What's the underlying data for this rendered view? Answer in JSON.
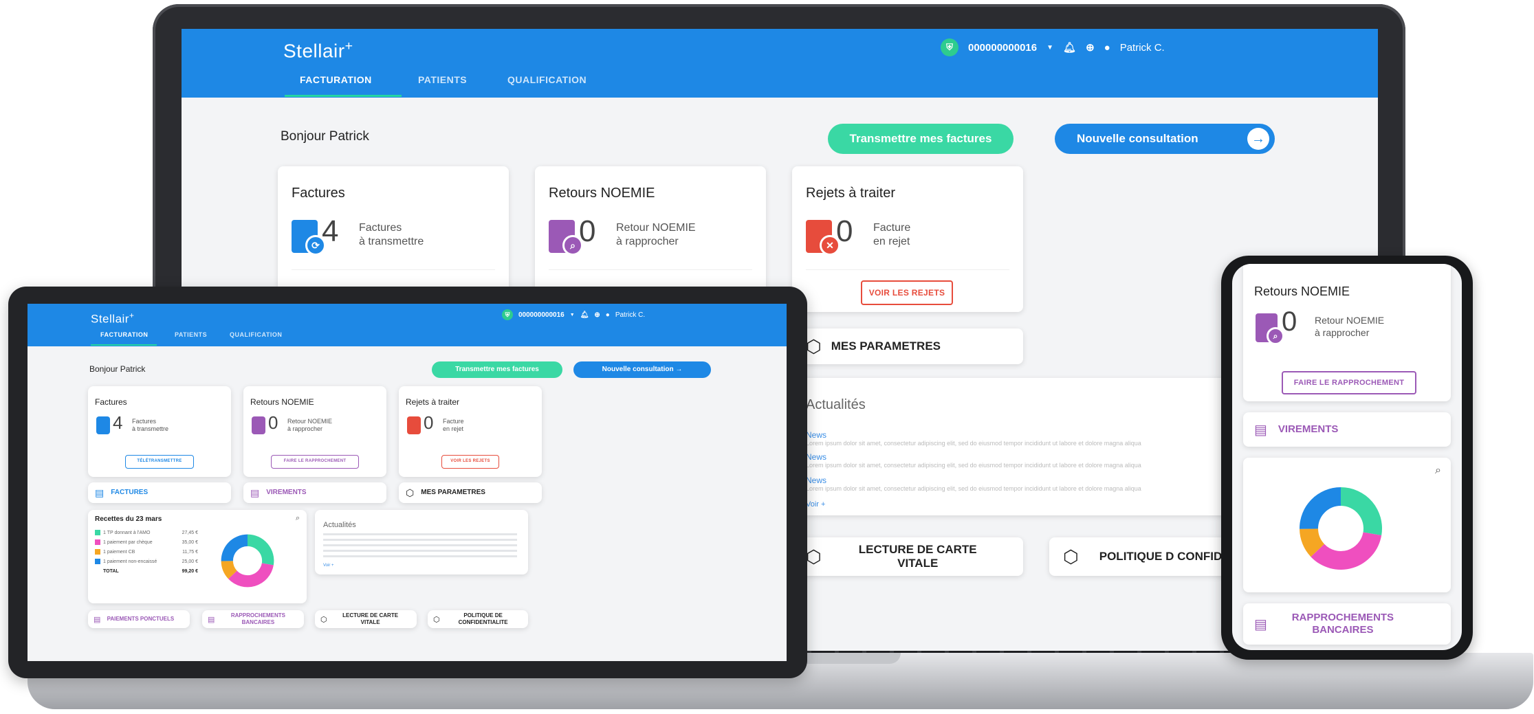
{
  "brand": "Stellair",
  "user": {
    "account_id": "000000000016",
    "name": "Patrick C."
  },
  "nav": {
    "tabs": [
      "FACTURATION",
      "PATIENTS",
      "QUALIFICATION"
    ]
  },
  "greeting": "Bonjour Patrick",
  "actions": {
    "transmit": "Transmettre mes factures",
    "new_consultation": "Nouvelle consultation"
  },
  "cards": {
    "factures": {
      "title": "Factures",
      "count": "4",
      "line1": "Factures",
      "line2": "à transmettre",
      "button": "TÉLÉTRANSMETTRE"
    },
    "noemie": {
      "title": "Retours NOEMIE",
      "count": "0",
      "line1": "Retour NOEMIE",
      "line2": "à rapprocher",
      "button": "FAIRE LE RAPPROCHEMENT"
    },
    "rejets": {
      "title": "Rejets à traiter",
      "count": "0",
      "line1": "Facture",
      "line2": "en rejet",
      "button": "VOIR LES REJETS"
    }
  },
  "tiles": {
    "factures": "FACTURES",
    "virements": "VIREMENTS",
    "parametres": "MES PARAMETRES",
    "paiements": "PAIEMENTS PONCTUELS",
    "rapprochements": "RAPPROCHEMENTS BANCAIRES",
    "carte_vitale": "LECTURE DE CARTE VITALE",
    "politique": "POLITIQUE DE CONFIDENTIALITE",
    "politique_cropped": "POLITIQUE D CONFIDENTIAL",
    "rapprochements_cropped": "RAPPROCHEMENTS BANCAIRES"
  },
  "news": {
    "title": "Actualités",
    "items": [
      "News",
      "News",
      "News"
    ],
    "more": "Voir +",
    "body": "Lorem ipsum dolor sit amet, consectetur adipiscing elit, sed do eiusmod tempor incididunt ut labore et dolore magna aliqua"
  },
  "recettes": {
    "title": "Recettes du 23 mars",
    "rows": [
      {
        "label": "1 TP donnant à l'AMO",
        "value": "27,45 €",
        "color": "#3ad8a4"
      },
      {
        "label": "1 paiement par chèque",
        "value": "35,00 €",
        "color": "#ef4fbf"
      },
      {
        "label": "1 paiement CB",
        "value": "11,75 €",
        "color": "#f5a623"
      },
      {
        "label": "1 paiement non-encaissé",
        "value": "25,00 €",
        "color": "#1e88e5"
      }
    ],
    "total_label": "TOTAL",
    "total_value": "99,20 €"
  },
  "chart_data": {
    "type": "pie",
    "categories": [
      "1 TP donnant à l'AMO",
      "1 paiement par chèque",
      "1 paiement CB",
      "1 paiement non-encaissé"
    ],
    "values": [
      27.45,
      35.0,
      11.75,
      25.0
    ],
    "colors": [
      "#3ad8a4",
      "#ef4fbf",
      "#f5a623",
      "#1e88e5"
    ],
    "title": "Recettes du 23 mars"
  },
  "colors": {
    "primary": "#1e88e5",
    "green": "#3ad8a4",
    "purple": "#9b59b6",
    "red": "#e74c3c"
  }
}
